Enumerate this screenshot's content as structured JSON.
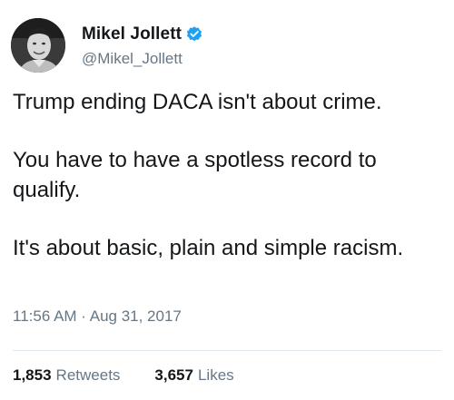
{
  "author": {
    "display_name": "Mikel Jollett",
    "handle": "@Mikel_Jollett",
    "verified": true,
    "verified_color": "#1da1f2"
  },
  "tweet": {
    "paragraphs": [
      "Trump ending DACA isn't about crime.",
      "You have to have a spotless record to qualify.",
      "It's about basic, plain and simple racism."
    ],
    "timestamp": "11:56 AM · Aug 31, 2017"
  },
  "stats": {
    "retweets_count": "1,853",
    "retweets_label": "Retweets",
    "likes_count": "3,657",
    "likes_label": "Likes"
  },
  "colors": {
    "text_primary": "#14171a",
    "text_secondary": "#657786",
    "divider": "#e1e8ed"
  }
}
